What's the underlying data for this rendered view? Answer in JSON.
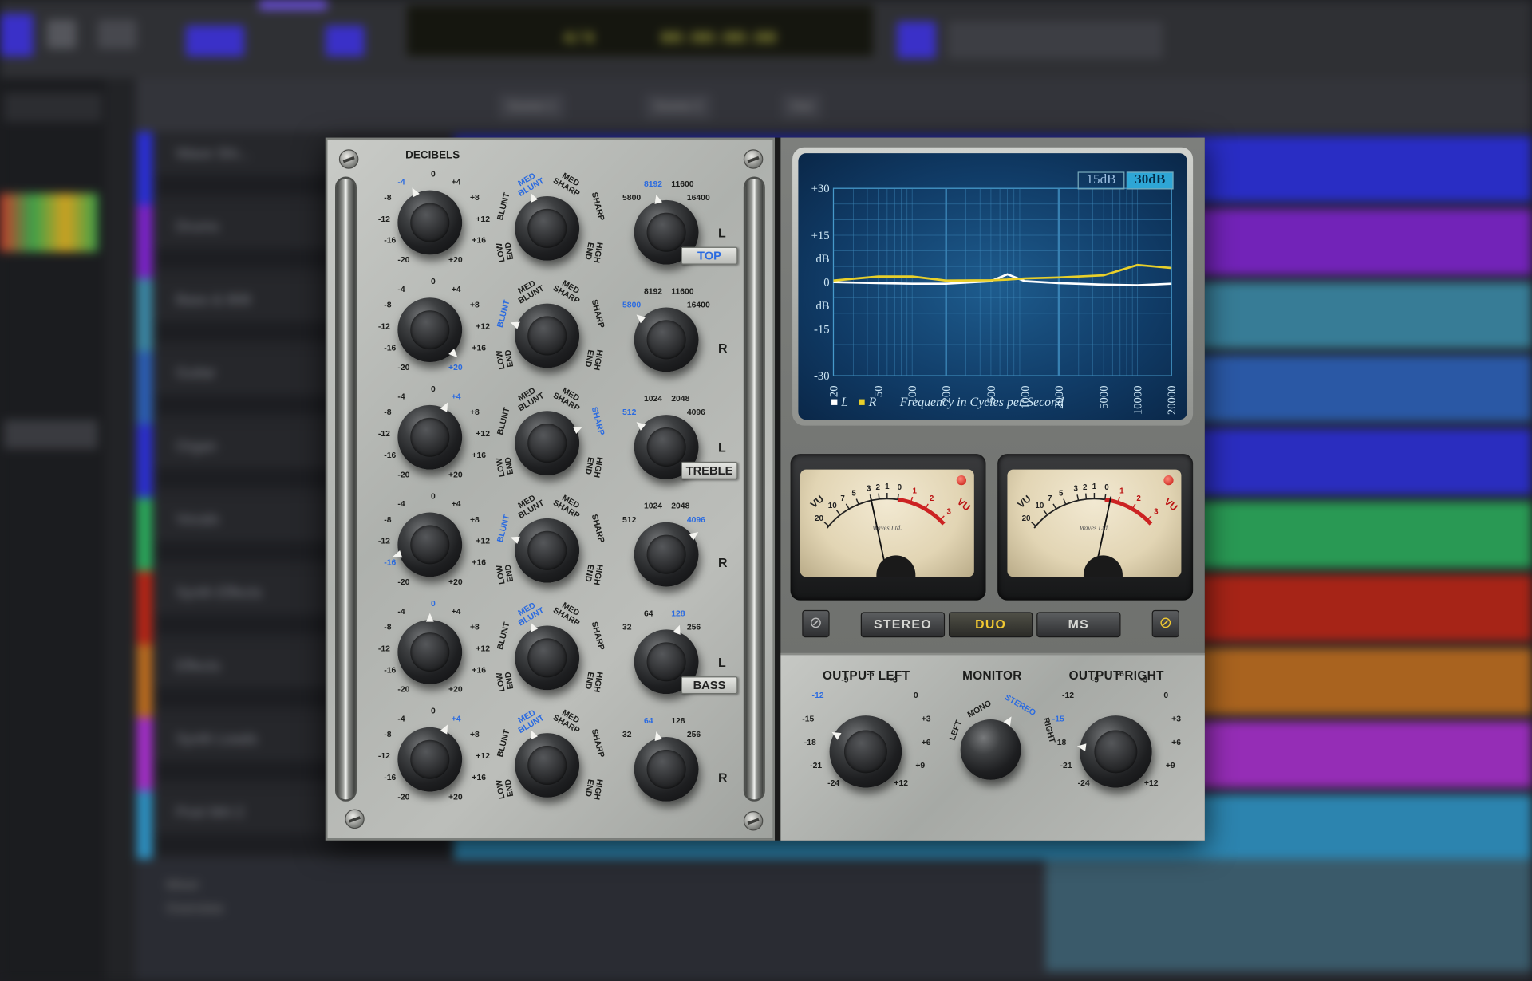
{
  "daw": {
    "track_names": [
      "Wave Shi...",
      "Drums",
      "Bass & 808",
      "Guitar",
      "Organ",
      "Vocals",
      "Synth Effects",
      "Effects",
      "Synth Leads",
      "Post Wrt 2"
    ],
    "track_colors": [
      "#2a2fd6",
      "#7b23c9",
      "#3a86a3",
      "#2b5eb4",
      "#2b2fd0",
      "#2aa65a",
      "#b52516",
      "#b86a1f",
      "#a22fc7",
      "#2d8fbf"
    ],
    "ruler_tabs": [
      "Scene 1",
      "Scene 2",
      "Out"
    ],
    "lcd_values": [
      "4/4",
      "00:00:00:00"
    ],
    "bottom_labels": [
      "Mixer",
      "Overview"
    ]
  },
  "eq": {
    "decibels_label": "DECIBELS",
    "db_scale": [
      "-4",
      "0",
      "+4",
      "-8",
      "+8",
      "-12",
      "+12",
      "-16",
      "+16",
      "-20",
      "+20"
    ],
    "shape_scale": [
      "MED BLUNT",
      "MED SHARP",
      "BLUNT",
      "SHARP",
      "LOW END",
      "HIGH END"
    ],
    "bands": [
      {
        "freqs": [
          "5800",
          "8192",
          "11600",
          "16400"
        ],
        "channel": "L",
        "db_sel": "-4",
        "shape_sel": "MED BLUNT",
        "freq_sel": "8192"
      },
      {
        "freqs": [
          "5800",
          "8192",
          "11600",
          "16400"
        ],
        "channel": "R",
        "db_sel": "+20",
        "shape_sel": "BLUNT",
        "freq_sel": "5800"
      },
      {
        "freqs": [
          "512",
          "1024",
          "2048",
          "4096"
        ],
        "channel": "L",
        "db_sel": "+4",
        "shape_sel": "SHARP",
        "freq_sel": "512"
      },
      {
        "freqs": [
          "512",
          "1024",
          "2048",
          "4096"
        ],
        "channel": "R",
        "db_sel": "-16",
        "shape_sel": "BLUNT",
        "freq_sel": "4096"
      },
      {
        "freqs": [
          "32",
          "64",
          "128",
          "256"
        ],
        "channel": "L",
        "db_sel": "0",
        "shape_sel": "MED BLUNT",
        "freq_sel": "128"
      },
      {
        "freqs": [
          "32",
          "64",
          "128",
          "256"
        ],
        "channel": "R",
        "db_sel": "+4",
        "shape_sel": "MED BLUNT",
        "freq_sel": "64"
      }
    ],
    "section_tags": [
      "TOP",
      "TREBLE",
      "BASS"
    ]
  },
  "graph": {
    "range_buttons": [
      "15dB",
      "30dB"
    ],
    "range_selected": "30dB",
    "y_ticks": [
      "+30",
      "+15",
      "dB",
      "0",
      "dB",
      "-15",
      "-30"
    ],
    "x_ticks": [
      "20",
      "50",
      "100",
      "200",
      "500",
      "1000",
      "2000",
      "5000",
      "10000",
      "20000"
    ],
    "legend_l": "L",
    "legend_r": "R",
    "caption": "Frequency in Cycles per Second",
    "color_l": "#ffffff",
    "color_r": "#e8cf2a"
  },
  "chart_data": {
    "type": "line",
    "x": [
      20,
      50,
      100,
      200,
      500,
      700,
      1000,
      2000,
      5000,
      10000,
      20000
    ],
    "series": [
      {
        "name": "L",
        "values": [
          0,
          -0.3,
          -0.5,
          -0.5,
          0.3,
          2.5,
          0.3,
          -0.3,
          -0.8,
          -1,
          -0.5
        ]
      },
      {
        "name": "R",
        "values": [
          0.5,
          1.8,
          1.8,
          0.5,
          0.6,
          0.8,
          1.2,
          1.5,
          2.2,
          5.5,
          4.5
        ]
      }
    ],
    "ylim": [
      -30,
      30
    ],
    "xscale": "log",
    "title": "",
    "xlabel": "Frequency in Cycles per Second",
    "ylabel": "dB"
  },
  "meters": {
    "scale": [
      "20",
      "10",
      "7",
      "5",
      "3",
      "2",
      "1",
      "0",
      "1",
      "2",
      "3"
    ],
    "label": "VU",
    "brand": "Waves Ltd.",
    "left_needle_level": -3,
    "right_needle_level": 0.2
  },
  "modes": {
    "buttons": [
      "STEREO",
      "DUO",
      "MS"
    ],
    "selected": "DUO",
    "left_icon": "bypass-icon",
    "right_icon": "link-icon"
  },
  "output": {
    "left_label": "OUTPUT LEFT",
    "monitor_label": "MONITOR",
    "right_label": "OUTPUT RIGHT",
    "out_scale": [
      "-12",
      "-9",
      "-6",
      "-3",
      "0",
      "-15",
      "+3",
      "-18",
      "+6",
      "-21",
      "+9",
      "-24",
      "+12"
    ],
    "left_value": "-12",
    "right_value": "-15",
    "monitor_options": [
      "LEFT",
      "MONO",
      "STEREO",
      "RIGHT"
    ],
    "monitor_selected": "STEREO"
  }
}
